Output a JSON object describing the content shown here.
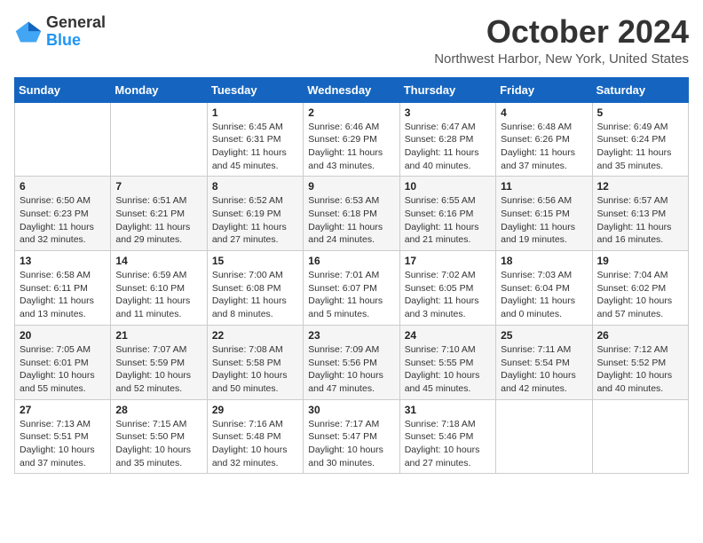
{
  "logo": {
    "general": "General",
    "blue": "Blue"
  },
  "header": {
    "month": "October 2024",
    "location": "Northwest Harbor, New York, United States"
  },
  "days_of_week": [
    "Sunday",
    "Monday",
    "Tuesday",
    "Wednesday",
    "Thursday",
    "Friday",
    "Saturday"
  ],
  "weeks": [
    [
      {
        "day": "",
        "info": ""
      },
      {
        "day": "",
        "info": ""
      },
      {
        "day": "1",
        "info": "Sunrise: 6:45 AM\nSunset: 6:31 PM\nDaylight: 11 hours and 45 minutes."
      },
      {
        "day": "2",
        "info": "Sunrise: 6:46 AM\nSunset: 6:29 PM\nDaylight: 11 hours and 43 minutes."
      },
      {
        "day": "3",
        "info": "Sunrise: 6:47 AM\nSunset: 6:28 PM\nDaylight: 11 hours and 40 minutes."
      },
      {
        "day": "4",
        "info": "Sunrise: 6:48 AM\nSunset: 6:26 PM\nDaylight: 11 hours and 37 minutes."
      },
      {
        "day": "5",
        "info": "Sunrise: 6:49 AM\nSunset: 6:24 PM\nDaylight: 11 hours and 35 minutes."
      }
    ],
    [
      {
        "day": "6",
        "info": "Sunrise: 6:50 AM\nSunset: 6:23 PM\nDaylight: 11 hours and 32 minutes."
      },
      {
        "day": "7",
        "info": "Sunrise: 6:51 AM\nSunset: 6:21 PM\nDaylight: 11 hours and 29 minutes."
      },
      {
        "day": "8",
        "info": "Sunrise: 6:52 AM\nSunset: 6:19 PM\nDaylight: 11 hours and 27 minutes."
      },
      {
        "day": "9",
        "info": "Sunrise: 6:53 AM\nSunset: 6:18 PM\nDaylight: 11 hours and 24 minutes."
      },
      {
        "day": "10",
        "info": "Sunrise: 6:55 AM\nSunset: 6:16 PM\nDaylight: 11 hours and 21 minutes."
      },
      {
        "day": "11",
        "info": "Sunrise: 6:56 AM\nSunset: 6:15 PM\nDaylight: 11 hours and 19 minutes."
      },
      {
        "day": "12",
        "info": "Sunrise: 6:57 AM\nSunset: 6:13 PM\nDaylight: 11 hours and 16 minutes."
      }
    ],
    [
      {
        "day": "13",
        "info": "Sunrise: 6:58 AM\nSunset: 6:11 PM\nDaylight: 11 hours and 13 minutes."
      },
      {
        "day": "14",
        "info": "Sunrise: 6:59 AM\nSunset: 6:10 PM\nDaylight: 11 hours and 11 minutes."
      },
      {
        "day": "15",
        "info": "Sunrise: 7:00 AM\nSunset: 6:08 PM\nDaylight: 11 hours and 8 minutes."
      },
      {
        "day": "16",
        "info": "Sunrise: 7:01 AM\nSunset: 6:07 PM\nDaylight: 11 hours and 5 minutes."
      },
      {
        "day": "17",
        "info": "Sunrise: 7:02 AM\nSunset: 6:05 PM\nDaylight: 11 hours and 3 minutes."
      },
      {
        "day": "18",
        "info": "Sunrise: 7:03 AM\nSunset: 6:04 PM\nDaylight: 11 hours and 0 minutes."
      },
      {
        "day": "19",
        "info": "Sunrise: 7:04 AM\nSunset: 6:02 PM\nDaylight: 10 hours and 57 minutes."
      }
    ],
    [
      {
        "day": "20",
        "info": "Sunrise: 7:05 AM\nSunset: 6:01 PM\nDaylight: 10 hours and 55 minutes."
      },
      {
        "day": "21",
        "info": "Sunrise: 7:07 AM\nSunset: 5:59 PM\nDaylight: 10 hours and 52 minutes."
      },
      {
        "day": "22",
        "info": "Sunrise: 7:08 AM\nSunset: 5:58 PM\nDaylight: 10 hours and 50 minutes."
      },
      {
        "day": "23",
        "info": "Sunrise: 7:09 AM\nSunset: 5:56 PM\nDaylight: 10 hours and 47 minutes."
      },
      {
        "day": "24",
        "info": "Sunrise: 7:10 AM\nSunset: 5:55 PM\nDaylight: 10 hours and 45 minutes."
      },
      {
        "day": "25",
        "info": "Sunrise: 7:11 AM\nSunset: 5:54 PM\nDaylight: 10 hours and 42 minutes."
      },
      {
        "day": "26",
        "info": "Sunrise: 7:12 AM\nSunset: 5:52 PM\nDaylight: 10 hours and 40 minutes."
      }
    ],
    [
      {
        "day": "27",
        "info": "Sunrise: 7:13 AM\nSunset: 5:51 PM\nDaylight: 10 hours and 37 minutes."
      },
      {
        "day": "28",
        "info": "Sunrise: 7:15 AM\nSunset: 5:50 PM\nDaylight: 10 hours and 35 minutes."
      },
      {
        "day": "29",
        "info": "Sunrise: 7:16 AM\nSunset: 5:48 PM\nDaylight: 10 hours and 32 minutes."
      },
      {
        "day": "30",
        "info": "Sunrise: 7:17 AM\nSunset: 5:47 PM\nDaylight: 10 hours and 30 minutes."
      },
      {
        "day": "31",
        "info": "Sunrise: 7:18 AM\nSunset: 5:46 PM\nDaylight: 10 hours and 27 minutes."
      },
      {
        "day": "",
        "info": ""
      },
      {
        "day": "",
        "info": ""
      }
    ]
  ]
}
